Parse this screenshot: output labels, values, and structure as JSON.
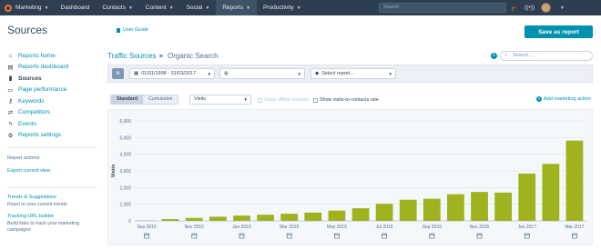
{
  "topnav": {
    "brand": "Marketing",
    "items": [
      "Dashboard",
      "Contacts",
      "Content",
      "Social",
      "Reports",
      "Productivity"
    ],
    "has_caret": [
      false,
      true,
      true,
      true,
      true,
      true
    ],
    "active_index": 4,
    "search_placeholder": "Search"
  },
  "header": {
    "title": "Sources",
    "user_guide": "User Guide",
    "save_button": "Save as report"
  },
  "sidebar": {
    "items": [
      {
        "label": "Reports home",
        "icon": "home-icon"
      },
      {
        "label": "Reports dashboard",
        "icon": "dashboard-icon"
      },
      {
        "label": "Sources",
        "icon": "chart-icon"
      },
      {
        "label": "Page performance",
        "icon": "page-icon"
      },
      {
        "label": "Keywords",
        "icon": "key-icon"
      },
      {
        "label": "Competitors",
        "icon": "competitors-icon"
      },
      {
        "label": "Events",
        "icon": "bolt-icon"
      },
      {
        "label": "Reports settings",
        "icon": "gear-icon"
      }
    ],
    "active_index": 2,
    "actions_heading": "Report actions",
    "export_link": "Export current view",
    "trends_link": "Trends & Suggestions",
    "trends_desc": "React to your current trends",
    "tracking_link": "Tracking URL builder",
    "tracking_desc": "Build links to track your marketing campaigns"
  },
  "main": {
    "crumb_link": "Traffic Sources",
    "crumb_current": "Organic Search",
    "search_placeholder": "Search...",
    "date_range": "01/01/1998 - 31/03/2017",
    "globe_value": "",
    "report_select": "Select report...",
    "view_toggle": [
      "Standard",
      "Cumulative"
    ],
    "metric": "Visits",
    "offline_checkbox": "Show offline sources",
    "ratio_checkbox": "Show visits-to-contacts rate",
    "add_marketing": "Add marketing action"
  },
  "colors": {
    "nav_bg": "#2d3e50",
    "accent": "#0091ae",
    "bar": "#a0b31e",
    "logo": "#f57722"
  },
  "chart_data": {
    "type": "bar",
    "ylabel": "Visits",
    "ylim": [
      0,
      6000
    ],
    "yticks": [
      0,
      1000,
      2000,
      3000,
      4000,
      5000,
      6000
    ],
    "ytick_labels": [
      "0",
      "1,000",
      "2,000",
      "3,000",
      "4,000",
      "5,000",
      "6,000"
    ],
    "categories": [
      "Sep 2015",
      "Oct 2015",
      "Nov 2015",
      "Dec 2015",
      "Jan 2016",
      "Feb 2016",
      "Mar 2016",
      "Apr 2016",
      "May 2016",
      "Jun 2016",
      "Jul 2016",
      "Aug 2016",
      "Sep 2016",
      "Oct 2016",
      "Nov 2016",
      "Dec 2016",
      "Jan 2017",
      "Feb 2017",
      "Mar 2017"
    ],
    "xtick_labels": [
      "Sep 2015",
      "",
      "Nov 2015",
      "",
      "Jan 2016",
      "",
      "Mar 2016",
      "",
      "May 2016",
      "",
      "Jul 2016",
      "",
      "Sep 2016",
      "",
      "Nov 2016",
      "",
      "Jan 2017",
      "",
      "Mar 2017"
    ],
    "values": [
      20,
      110,
      180,
      250,
      320,
      370,
      430,
      500,
      620,
      760,
      1030,
      1270,
      1330,
      1600,
      1740,
      1700,
      2840,
      3420,
      4820
    ],
    "grid": true,
    "annotation_icon": "calendar-note-icon"
  }
}
